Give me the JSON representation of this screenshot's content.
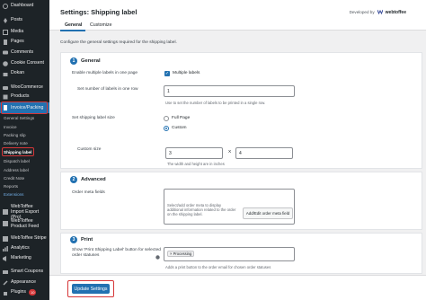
{
  "sidebar": {
    "items": [
      {
        "label": "Dashboard",
        "icon": "dashboard-icon"
      },
      {
        "label": "Posts",
        "icon": "pin-icon"
      },
      {
        "label": "Media",
        "icon": "media-icon"
      },
      {
        "label": "Pages",
        "icon": "page-icon"
      },
      {
        "label": "Comments",
        "icon": "comment-icon"
      },
      {
        "label": "Cookie Consent",
        "icon": "cookie-icon"
      },
      {
        "label": "Dokan",
        "icon": "store-icon"
      },
      {
        "label": "WooCommerce",
        "icon": "woo-icon"
      },
      {
        "label": "Products",
        "icon": "box-icon"
      },
      {
        "label": "Invoice/Packing",
        "icon": "invoice-icon"
      }
    ],
    "sub_items": [
      "General Settings",
      "Invoice",
      "Packing slip",
      "Delivery note",
      "Shipping label",
      "Dispatch label",
      "Address label",
      "Credit Note",
      "Reports",
      "Extensions"
    ],
    "lower_items": [
      {
        "label": "WebToffee Import Export (Pro)",
        "icon": "import-icon"
      },
      {
        "label": "WebToffee Product Feed",
        "icon": "feed-icon"
      },
      {
        "label": "WebToffee Stripe",
        "icon": "stripe-icon"
      },
      {
        "label": "Analytics",
        "icon": "analytics-icon"
      },
      {
        "label": "Marketing",
        "icon": "megaphone-icon"
      },
      {
        "label": "Smart Coupons",
        "icon": "coupon-icon"
      },
      {
        "label": "Appearance",
        "icon": "brush-icon"
      },
      {
        "label": "Plugins",
        "icon": "plugin-icon"
      }
    ],
    "plugins_badge": "10"
  },
  "header": {
    "title": "Settings: Shipping label",
    "developed_by": "Developed by",
    "developer": "webtoffee",
    "tabs": [
      "General",
      "Customize"
    ]
  },
  "description": "Configure the general settings required for the shipping label.",
  "general": {
    "num": "1",
    "title": "General",
    "multi_label": "Enable multiple labels in one page",
    "multi_option": "Multiple labels",
    "num_labels_label": "Set number of labels in one row",
    "num_labels_value": "1",
    "num_labels_help": "Use to set the number of labels to be printed in a single row.",
    "size_label": "Set shipping label size",
    "size_options": [
      "Full Page",
      "Custom"
    ],
    "custom_size_label": "Custom size",
    "width_value": "3",
    "height_value": "4",
    "times": "X",
    "size_help": "The width and height are in inches"
  },
  "advanced": {
    "num": "2",
    "title": "Advanced",
    "meta_label": "Order meta fields",
    "meta_help": "Select/add order meta to display additional information related to the order on the shipping label.",
    "meta_button": "Add/Edit order meta field"
  },
  "print": {
    "num": "3",
    "title": "Print",
    "show_label": "Show 'Print Shipping Label' button for selected order statuses",
    "status_tag": "× Processing",
    "help": "Adds a print button to the order email for chosen order statuses"
  },
  "footer": {
    "update_button": "Update Settings"
  },
  "colors": {
    "accent": "#2271b1",
    "sidebar_bg": "#1d2327",
    "highlight_box": "#d63638"
  }
}
